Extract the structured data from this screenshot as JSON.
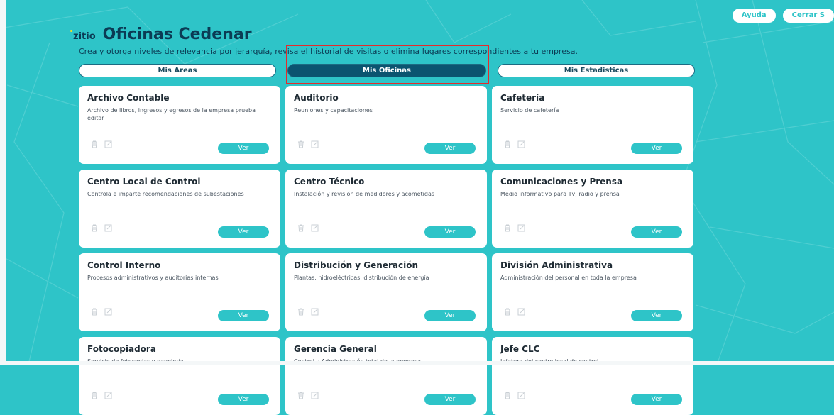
{
  "header": {
    "logo_text": "zitio",
    "title": "Oficinas Cedenar",
    "subtitle": "Crea y otorga niveles de relevancia por jerarquía, revisa el historial de visitas o elimina lugares correspondientes a tu empresa."
  },
  "top_actions": {
    "help": "Ayuda",
    "logout": "Cerrar S"
  },
  "tabs": [
    "Mis Areas",
    "Mis Oficinas",
    "Mis Estadisticas"
  ],
  "active_tab": "Mis Oficinas",
  "card_action_label": "Ver",
  "icons": {
    "delete": "trash-icon",
    "edit": "edit-icon"
  },
  "colors": {
    "background": "#2ec4c8",
    "accent": "#0b5470",
    "highlight": "#e52b2b"
  },
  "offices": [
    {
      "name": "Archivo Contable",
      "description": "Archivo de libros, ingresos y egresos de la empresa prueba editar"
    },
    {
      "name": "Auditorio",
      "description": "Reuniones y capacitaciones"
    },
    {
      "name": "Cafetería",
      "description": "Servicio de cafetería"
    },
    {
      "name": "Centro Local de Control",
      "description": "Controla e imparte recomendaciones de subestaciones"
    },
    {
      "name": "Centro Técnico",
      "description": "Instalación y revisión de medidores y acometidas"
    },
    {
      "name": "Comunicaciones y Prensa",
      "description": "Medio informativo para Tv, radio y prensa"
    },
    {
      "name": "Control Interno",
      "description": "Procesos administrativos y auditorias internas"
    },
    {
      "name": "Distribución y Generación",
      "description": "Plantas, hidroeléctricas, distribución de energía"
    },
    {
      "name": "División Administrativa",
      "description": "Administración del personal en toda la empresa"
    },
    {
      "name": "Fotocopiadora",
      "description": "Servicio de fotocopias y papelería"
    },
    {
      "name": "Gerencia General",
      "description": "Control y Administración total de la empresa"
    },
    {
      "name": "Jefe CLC",
      "description": "Jefatura del centro local de control"
    }
  ]
}
